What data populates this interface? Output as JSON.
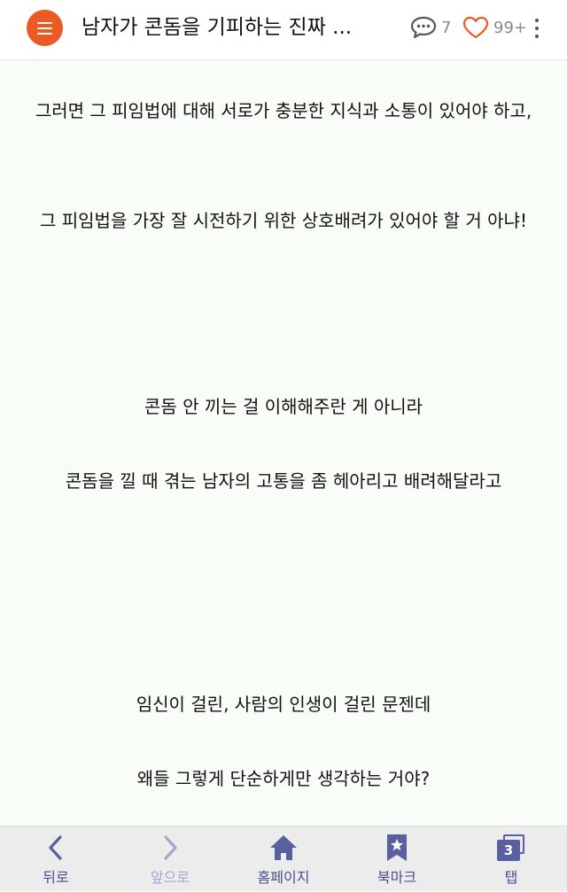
{
  "header": {
    "title": "남자가 콘돔을 기피하는 진짜 ...",
    "comment_count": "7",
    "like_count": "99+",
    "accent_color": "#ec5a24",
    "icons": {
      "menu": "hamburger-menu-icon",
      "comment": "speech-bubble-icon",
      "like": "heart-icon",
      "more": "vertical-dots-icon"
    }
  },
  "content": {
    "paragraphs": [
      "그러면 그 피임법에 대해 서로가 충분한 지식과 소통이 있어야 하고,",
      "그 피임법을 가장 잘 시전하기 위한 상호배려가 있어야 할 거 아냐!",
      "콘돔 안 끼는 걸 이해해주란 게 아니라",
      "콘돔을 낄 때 겪는 남자의 고통을 좀 헤아리고 배려해달라고",
      "임신이 걸린, 사람의 인생이 걸린 문젠데",
      "왜들 그렇게 단순하게만 생각하는 거야?"
    ]
  },
  "bottom_nav": {
    "back_label": "뒤로",
    "forward_label": "앞으로",
    "home_label": "홈페이지",
    "bookmark_label": "북마크",
    "tabs_label": "탭",
    "tab_count": "3",
    "nav_color": "#4a4f8c"
  }
}
